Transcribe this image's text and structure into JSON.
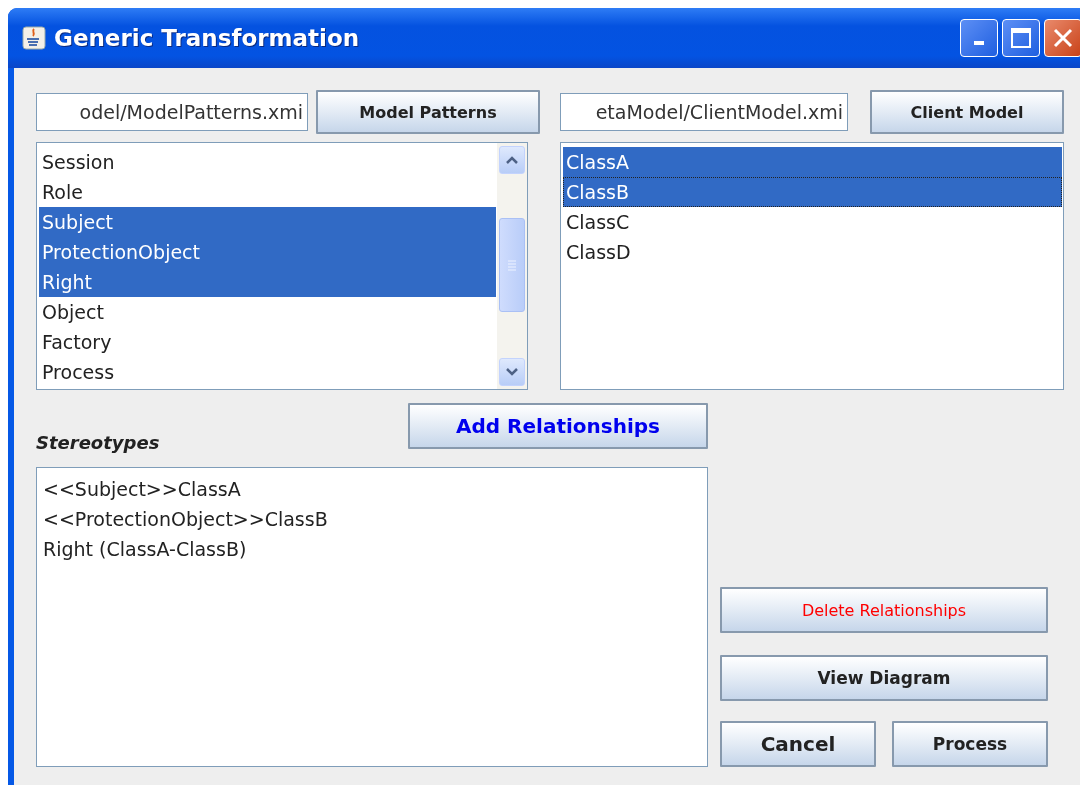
{
  "window": {
    "title": "Generic Transformation"
  },
  "model_patterns": {
    "path": "odel/ModelPatterns.xmi",
    "button": {
      "label": "Model Patterns",
      "color": "#222222"
    },
    "items": [
      {
        "label": "Session",
        "selected": false
      },
      {
        "label": "Role",
        "selected": false
      },
      {
        "label": "Subject",
        "selected": true
      },
      {
        "label": "ProtectionObject",
        "selected": true
      },
      {
        "label": "Right",
        "selected": true
      },
      {
        "label": "Object",
        "selected": false
      },
      {
        "label": "Factory",
        "selected": false
      },
      {
        "label": "Process",
        "selected": false
      }
    ]
  },
  "client_model": {
    "path": "etaModel/ClientModel.xmi",
    "button": {
      "label": "Client Model",
      "color": "#222222"
    },
    "items": [
      {
        "label": "ClassA",
        "selected": true,
        "focused": false
      },
      {
        "label": "ClassB",
        "selected": true,
        "focused": true
      },
      {
        "label": "ClassC",
        "selected": false,
        "focused": false
      },
      {
        "label": "ClassD",
        "selected": false,
        "focused": false
      }
    ]
  },
  "add_button": {
    "label": "Add Relationships",
    "color": "#0000ee"
  },
  "stereotypes": {
    "label": "Stereotypes",
    "lines": [
      "<<Subject>>ClassA",
      "<<ProtectionObject>>ClassB",
      "Right (ClassA-ClassB)"
    ]
  },
  "delete_button": {
    "label": "Delete Relationships",
    "color": "#ff0000"
  },
  "view_button": {
    "label": "View Diagram",
    "color": "#222222"
  },
  "cancel_button": {
    "label": "Cancel",
    "color": "#222222"
  },
  "process_button": {
    "label": "Process",
    "color": "#222222"
  }
}
